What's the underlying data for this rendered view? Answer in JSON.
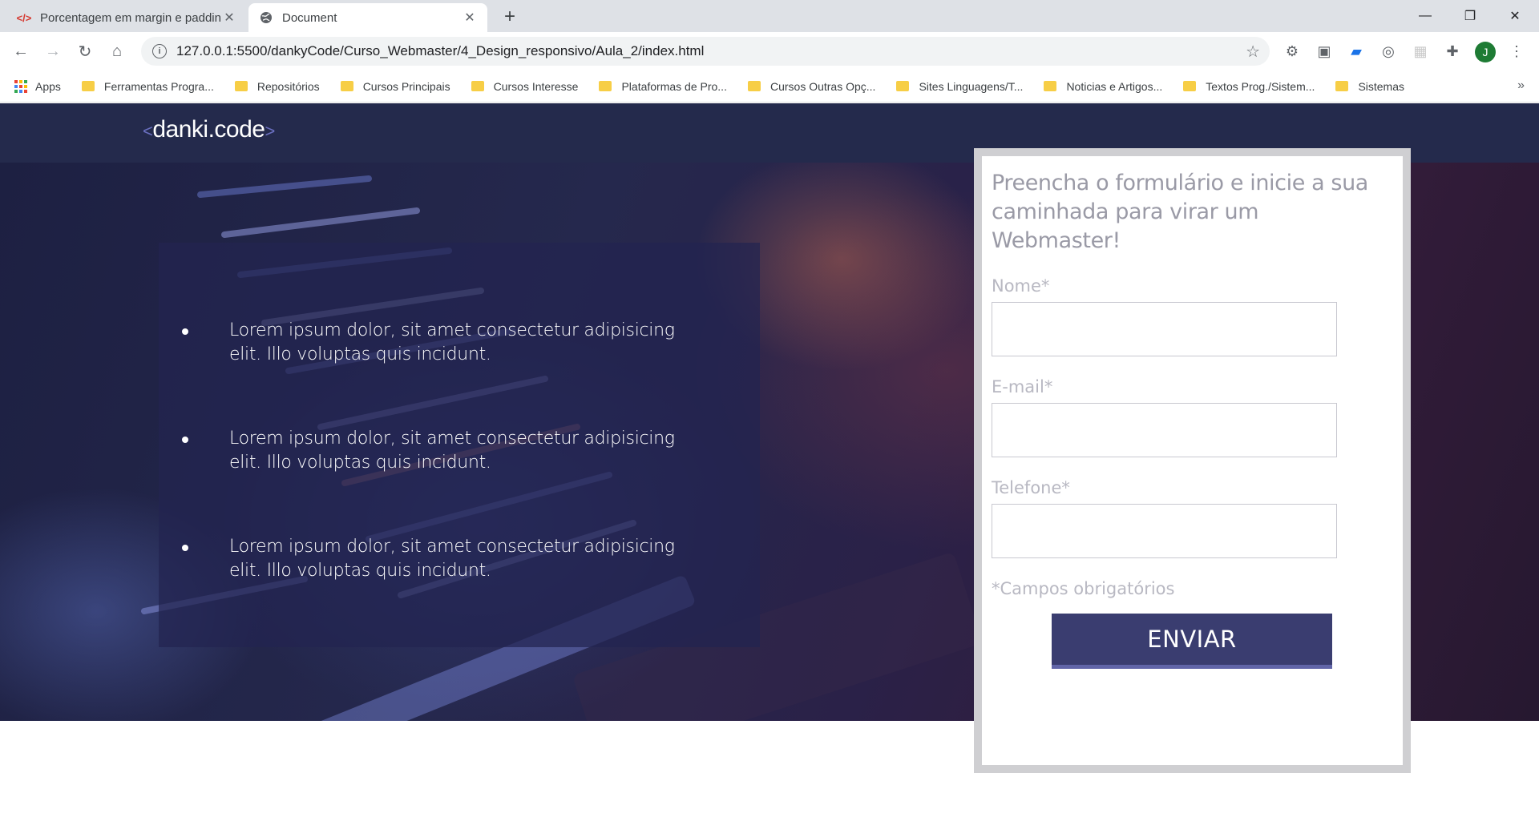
{
  "browser": {
    "tabs": [
      {
        "title": "Porcentagem em margin e padding",
        "favicon": "code-icon"
      },
      {
        "title": "Document",
        "favicon": "globe-icon"
      }
    ],
    "url": "127.0.0.1:5500/dankyCode/Curso_Webmaster/4_Design_responsivo/Aula_2/index.html",
    "avatar_letter": "J",
    "bookmarks": [
      "Apps",
      "Ferramentas Progra...",
      "Repositórios",
      "Cursos Principais",
      "Cursos Interesse",
      "Plataformas de Pro...",
      "Cursos Outras Opç...",
      "Sites Linguagens/T...",
      "Noticias e Artigos...",
      "Textos Prog./Sistem...",
      "Sistemas"
    ]
  },
  "site": {
    "logo": {
      "left": "<",
      "name": "danki",
      "dot": ".",
      "suffix": "code",
      "right": ">"
    },
    "bullets": [
      "Lorem ipsum dolor, sit amet consectetur adipisicing elit. Illo voluptas quis incidunt.",
      "Lorem ipsum dolor, sit amet consectetur adipisicing elit. Illo voluptas quis incidunt.",
      "Lorem ipsum dolor, sit amet consectetur adipisicing elit. Illo voluptas quis incidunt."
    ],
    "form": {
      "heading": "Preencha o formulário e inicie a sua caminhada para virar um Webmaster!",
      "name_label": "Nome*",
      "email_label": "E-mail*",
      "phone_label": "Telefone*",
      "required_note": "*Campos obrigatórios",
      "submit_label": "ENVIAR"
    }
  },
  "colors": {
    "header_bg": "#242a4c",
    "button_bg": "#3a3d70",
    "form_border": "#cfcfd2"
  }
}
